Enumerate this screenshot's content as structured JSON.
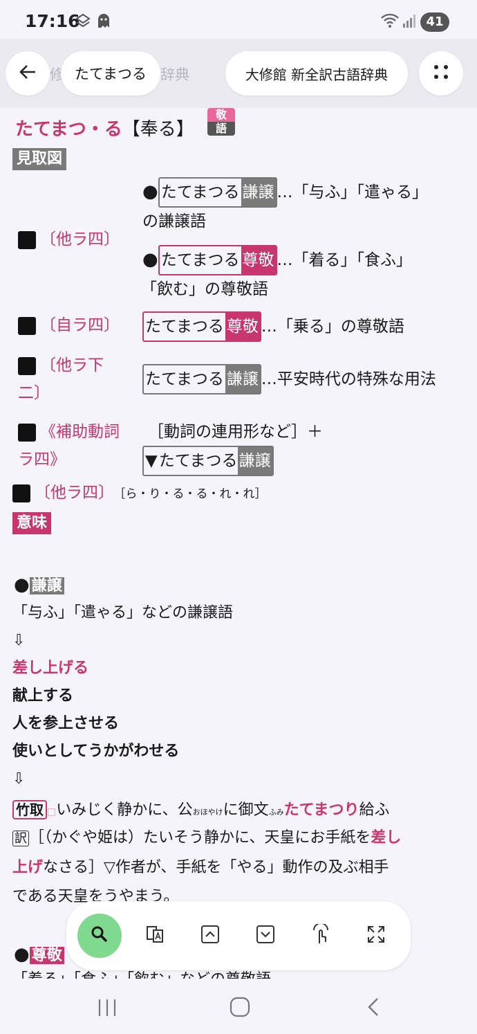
{
  "status": {
    "time": "17:16",
    "battery": "41"
  },
  "header": {
    "title_pill": "たてまつる",
    "dict_pill": "大修館 新全訳古語辞典",
    "faint_left": "修",
    "faint_mid": "辞典"
  },
  "entry": {
    "headword": "たてまつ・る",
    "kanji": "【奉る】",
    "badge_top": "敬",
    "badge_bottom": "語",
    "overview_label": "見取図",
    "rows": [
      {
        "pos": "〔他ラ四〕"
      },
      {
        "pos": "〔自ラ四〕"
      },
      {
        "pos_a": "〔他ラ下",
        "pos_b": "二〕"
      },
      {
        "pos_a": "《補助動詞",
        "pos_b": "ラ四》"
      }
    ],
    "word": "たてまつる",
    "kenjo": "謙譲",
    "sonkei": "尊敬",
    "r1a_tail": "…「与ふ」「遣ゃる」",
    "r1a_line2": "の謙譲語",
    "r1b_tail": "…「着る」「食ふ」",
    "r1b_line2": "「飲む」の尊敬語",
    "r2_tail": "…「乗る」の尊敬語",
    "r3_tail": "…平安時代の特殊な用法",
    "r4_line1": "［動詞の連用形など］＋",
    "r4_prefix": "▼",
    "conj_pos": "〔他ラ四〕",
    "conj": "［ら・り・る・る・れ・れ］",
    "meaning_label": "意味",
    "m1_def": "「与ふ」「遣ゃる」などの謙譲語",
    "arrow": "⇩",
    "m1_t1": "差し上げる",
    "m1_t2": "献上する",
    "m1_t3": "人を参上させる",
    "m1_t4": "使いとしてうかがわせる",
    "src": "竹取",
    "ex_a": "いみじく静かに、公",
    "ex_ruby1": "おほやけ",
    "ex_b": "に御文",
    "ex_ruby2": "ふみ",
    "ex_c": "たてまつり",
    "ex_d": "給ふ",
    "yaku": "訳",
    "tr_a": "［（かぐや姫は）たいそう静かに、天皇にお手紙を",
    "tr_b": "差し",
    "tr_c": "上げ",
    "tr_d": "なさる］▽作者が、手紙を「やる」動作の及ぶ相手",
    "tr_e": "である天皇をうやまう。",
    "m2_partial": "「着る」「食ふ」「飲む」などの尊敬語"
  },
  "colors": {
    "accent": "#c8366e",
    "search": "#7fd98e"
  },
  "icons": [
    "back-arrow-icon",
    "more-dots-icon",
    "search-icon",
    "translate-icon",
    "chevron-up-icon",
    "chevron-down-icon",
    "touch-icon",
    "fullscreen-icon"
  ]
}
